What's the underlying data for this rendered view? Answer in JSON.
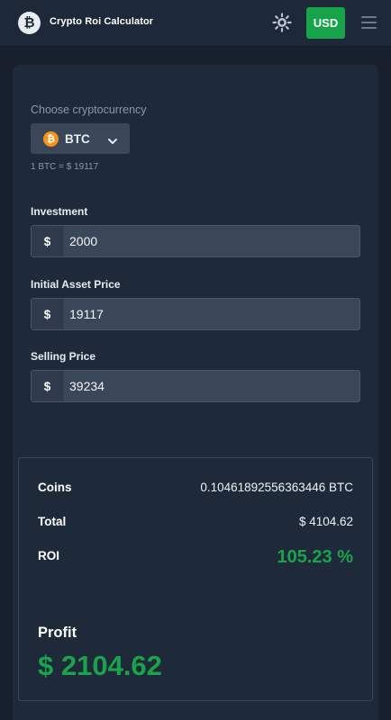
{
  "header": {
    "logo_glyph": "₿",
    "title": "Crypto Roi Calculator",
    "currency_button": "USD",
    "icons": [
      "bitcoin-logo-icon",
      "sun-icon",
      "hamburger-menu-icon"
    ],
    "accent_color": "#16a34a"
  },
  "selector": {
    "label": "Choose cryptocurrency",
    "coin_glyph": "₿",
    "selected": "BTC",
    "rate_text": "1 BTC = $ 19117"
  },
  "form": {
    "investment": {
      "label": "Investment",
      "prefix": "$",
      "value": "2000"
    },
    "initial_price": {
      "label": "Initial Asset Price",
      "prefix": "$",
      "value": "19117"
    },
    "selling_price": {
      "label": "Selling Price",
      "prefix": "$",
      "value": "39234"
    }
  },
  "results": {
    "coins": {
      "label": "Coins",
      "value": "0.10461892556363446 BTC"
    },
    "total": {
      "label": "Total",
      "value": "$ 4104.62"
    },
    "roi": {
      "label": "ROI",
      "value": "105.23 %"
    },
    "profit": {
      "label": "Profit",
      "value": "$ 2104.62"
    },
    "positive_color": "#1aa34a"
  }
}
